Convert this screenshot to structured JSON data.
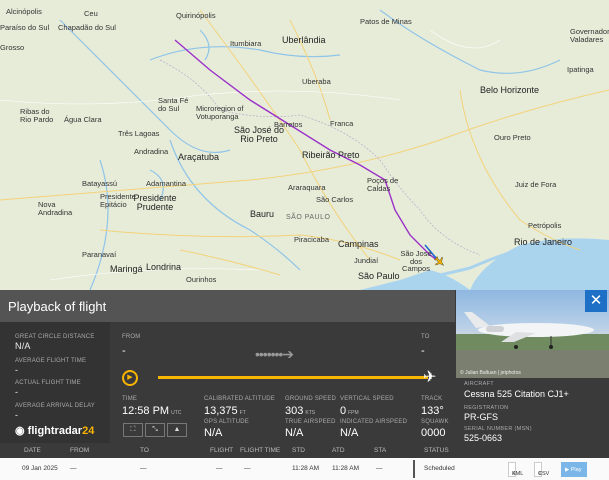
{
  "map": {
    "cities": [
      {
        "name": "Alcinópolis",
        "big": false
      },
      {
        "name": "Ceu",
        "big": false
      },
      {
        "name": "Paraíso do Sul",
        "big": false
      },
      {
        "name": "Chapadão do Sul",
        "big": false
      },
      {
        "name": "Grosso",
        "big": false
      },
      {
        "name": "Quirinópolis",
        "big": false
      },
      {
        "name": "Itumbiara",
        "big": false
      },
      {
        "name": "Uberlândia",
        "big": true
      },
      {
        "name": "Patos de Minas",
        "big": false
      },
      {
        "name": "Governador Valadares",
        "big": false
      },
      {
        "name": "Ribas do Rio Pardo",
        "big": false
      },
      {
        "name": "Água Clara",
        "big": false
      },
      {
        "name": "Três Lagoas",
        "big": false
      },
      {
        "name": "Santa Fé do Sul",
        "big": false
      },
      {
        "name": "Microregion of Votuporanga",
        "big": false
      },
      {
        "name": "Uberaba",
        "big": false
      },
      {
        "name": "Belo Horizonte",
        "big": true
      },
      {
        "name": "Ipatinga",
        "big": false
      },
      {
        "name": "São José do Rio Preto",
        "big": true
      },
      {
        "name": "Barretos",
        "big": false
      },
      {
        "name": "Franca",
        "big": false
      },
      {
        "name": "Ouro Preto",
        "big": false
      },
      {
        "name": "Andradina",
        "big": false
      },
      {
        "name": "Araçatuba",
        "big": true
      },
      {
        "name": "Ribeirão Preto",
        "big": true
      },
      {
        "name": "Batayassú",
        "big": false
      },
      {
        "name": "Adamantina",
        "big": false
      },
      {
        "name": "Presidente Epitácio",
        "big": false
      },
      {
        "name": "Presidente Prudente",
        "big": true
      },
      {
        "name": "Araraquara",
        "big": false
      },
      {
        "name": "Poços de Caldas",
        "big": false
      },
      {
        "name": "Juiz de Fora",
        "big": false
      },
      {
        "name": "São Carlos",
        "big": false
      },
      {
        "name": "Nova Andradina",
        "big": false
      },
      {
        "name": "Bauru",
        "big": true
      },
      {
        "name": "Petrópolis",
        "big": false
      },
      {
        "name": "Piracicaba",
        "big": false
      },
      {
        "name": "Campinas",
        "big": true
      },
      {
        "name": "Rio de Janeiro",
        "big": true
      },
      {
        "name": "Jundiaí",
        "big": false
      },
      {
        "name": "São José dos Campos",
        "big": false
      },
      {
        "name": "Paranavaí",
        "big": false
      },
      {
        "name": "Maringá",
        "big": false
      },
      {
        "name": "Londrina",
        "big": false
      },
      {
        "name": "São Paulo",
        "big": true
      },
      {
        "name": "Ourinhos",
        "big": false
      }
    ],
    "state_label": "SÃO PAULO"
  },
  "panel": {
    "title": "Playback of flight",
    "close": "✕",
    "photo_credit": "© Julian Baltuan | jetphotos",
    "great_circle_label": "GREAT CIRCLE DISTANCE",
    "great_circle_value": "N/A",
    "avg_flight_time_label": "AVERAGE FLIGHT TIME",
    "avg_flight_time_value": "-",
    "actual_flight_time_label": "ACTUAL FLIGHT TIME",
    "actual_flight_time_value": "-",
    "avg_arrival_delay_label": "AVERAGE ARRIVAL DELAY",
    "avg_arrival_delay_value": "-",
    "logo_text": "flightradar",
    "logo_num": "24",
    "from_label": "FROM",
    "from_value": "-",
    "to_label": "TO",
    "to_value": "-",
    "time_label": "TIME",
    "time_value": "12:58 PM",
    "time_unit": "UTC",
    "cal_alt_label": "CALIBRATED ALTITUDE",
    "cal_alt_value": "13,375",
    "cal_alt_unit": "FT",
    "gps_alt_label": "GPS ALTITUDE",
    "gps_alt_value": "N/A",
    "ground_speed_label": "GROUND SPEED",
    "ground_speed_value": "303",
    "ground_speed_unit": "KTS",
    "true_airspeed_label": "TRUE AIRSPEED",
    "true_airspeed_value": "N/A",
    "vertical_speed_label": "VERTICAL SPEED",
    "vertical_speed_value": "0",
    "vertical_speed_unit": "FPM",
    "indicated_airspeed_label": "INDICATED AIRSPEED",
    "indicated_airspeed_value": "N/A",
    "track_label": "TRACK",
    "track_value": "133°",
    "squawk_label": "SQUAWK",
    "squawk_value": "0000",
    "aircraft_label": "AIRCRAFT",
    "aircraft_value": "Cessna 525 Citation CJ1+",
    "registration_label": "REGISTRATION",
    "registration_value": "PR-GFS",
    "serial_label": "SERIAL NUMBER (MSN)",
    "serial_value": "525-0663"
  },
  "table": {
    "headers": {
      "date": "DATE",
      "from": "FROM",
      "to": "TO",
      "flight": "FLIGHT",
      "flight_time": "FLIGHT TIME",
      "std": "STD",
      "atd": "ATD",
      "sta": "STA",
      "status": "STATUS"
    },
    "row": {
      "date": "09 Jan 2025",
      "from": "—",
      "to": "—",
      "flight": "—",
      "flight_time": "—",
      "std": "11:28 AM",
      "atd": "11:28 AM",
      "sta": "—",
      "status": "Scheduled"
    },
    "buttons": {
      "kml": "KML",
      "csv": "CSV",
      "play": "▶ Play"
    }
  }
}
